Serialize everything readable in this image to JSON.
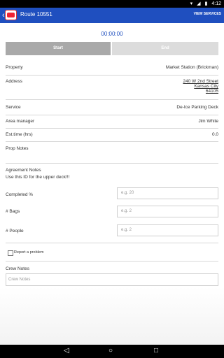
{
  "statusbar": {
    "time": "4:12",
    "icons": [
      "wifi-icon",
      "signal-icon",
      "battery-icon"
    ]
  },
  "appbar": {
    "title": "Route 10551",
    "action": "VIEW SERVICES"
  },
  "timer": "00:00:00",
  "actions": {
    "start": "Start",
    "end": "End"
  },
  "details": {
    "property": {
      "label": "Property",
      "value": "Market Station (Brickman)"
    },
    "address": {
      "label": "Address",
      "lines": [
        "240 W 2nd Street",
        "Kansas City",
        "64105"
      ]
    },
    "service": {
      "label": "Service",
      "value": "De-Ice Parking Deck"
    },
    "area_manager": {
      "label": "Area manager",
      "value": "Jim White"
    },
    "est_time": {
      "label": "Est.time (hrs)",
      "value": "0.0"
    },
    "prop_notes": {
      "label": "Prop Notes"
    },
    "agreement_notes": {
      "label": "Agreement Notes",
      "value": "Use this ID for the upper deck!!!"
    }
  },
  "inputs": {
    "completed": {
      "label": "Completed %",
      "placeholder": "e.g. 20"
    },
    "bags": {
      "label": "# Bags",
      "placeholder": "e.g. 2"
    },
    "people": {
      "label": "# People",
      "placeholder": "e.g. 2"
    }
  },
  "report": {
    "label": "Report a problem",
    "checked": false
  },
  "crew_notes": {
    "label": "Crew Notes",
    "placeholder": "Crew Notes"
  },
  "colors": {
    "accent": "#1f4fbf",
    "start_bg": "#a9a9a9",
    "end_bg": "#dcdcdc"
  }
}
